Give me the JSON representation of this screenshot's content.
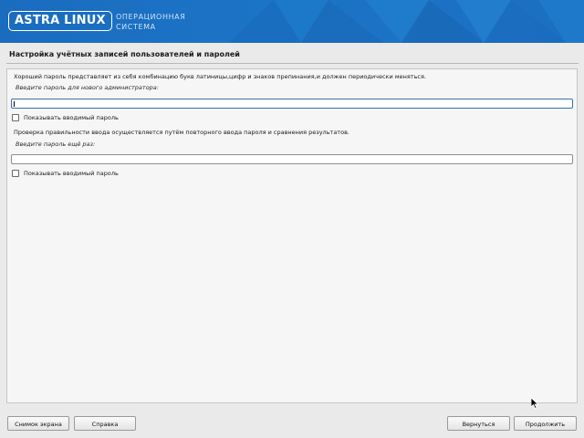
{
  "banner": {
    "logo_text": "ASTRA LINUX",
    "subtitle_line1": "ОПЕРАЦИОННАЯ",
    "subtitle_line2": "СИСТЕМА"
  },
  "page": {
    "title": "Настройка учётных записей пользователей и паролей"
  },
  "form": {
    "intro": "Хороший пароль представляет из себя комбинацию букв латиницы,цифр и знаков препинания,и должен периодически меняться.",
    "password_prompt": "Введите пароль для нового администратора:",
    "password_value": "",
    "show_password_label_1": "Показывать вводимый пароль",
    "verify_intro": "Проверка правильности ввода осуществляется путём повторного ввода пароля и сравнения результатов.",
    "verify_prompt": "Введите пароль ещё раз:",
    "verify_value": "",
    "show_password_label_2": "Показывать вводимый пароль"
  },
  "buttons": {
    "screenshot": "Снимок экрана",
    "help": "Справка",
    "back": "Вернуться",
    "continue": "Продолжить"
  },
  "colors": {
    "banner_blue": "#1a6cbf",
    "background": "#eaeaea",
    "panel": "#f6f6f6"
  }
}
